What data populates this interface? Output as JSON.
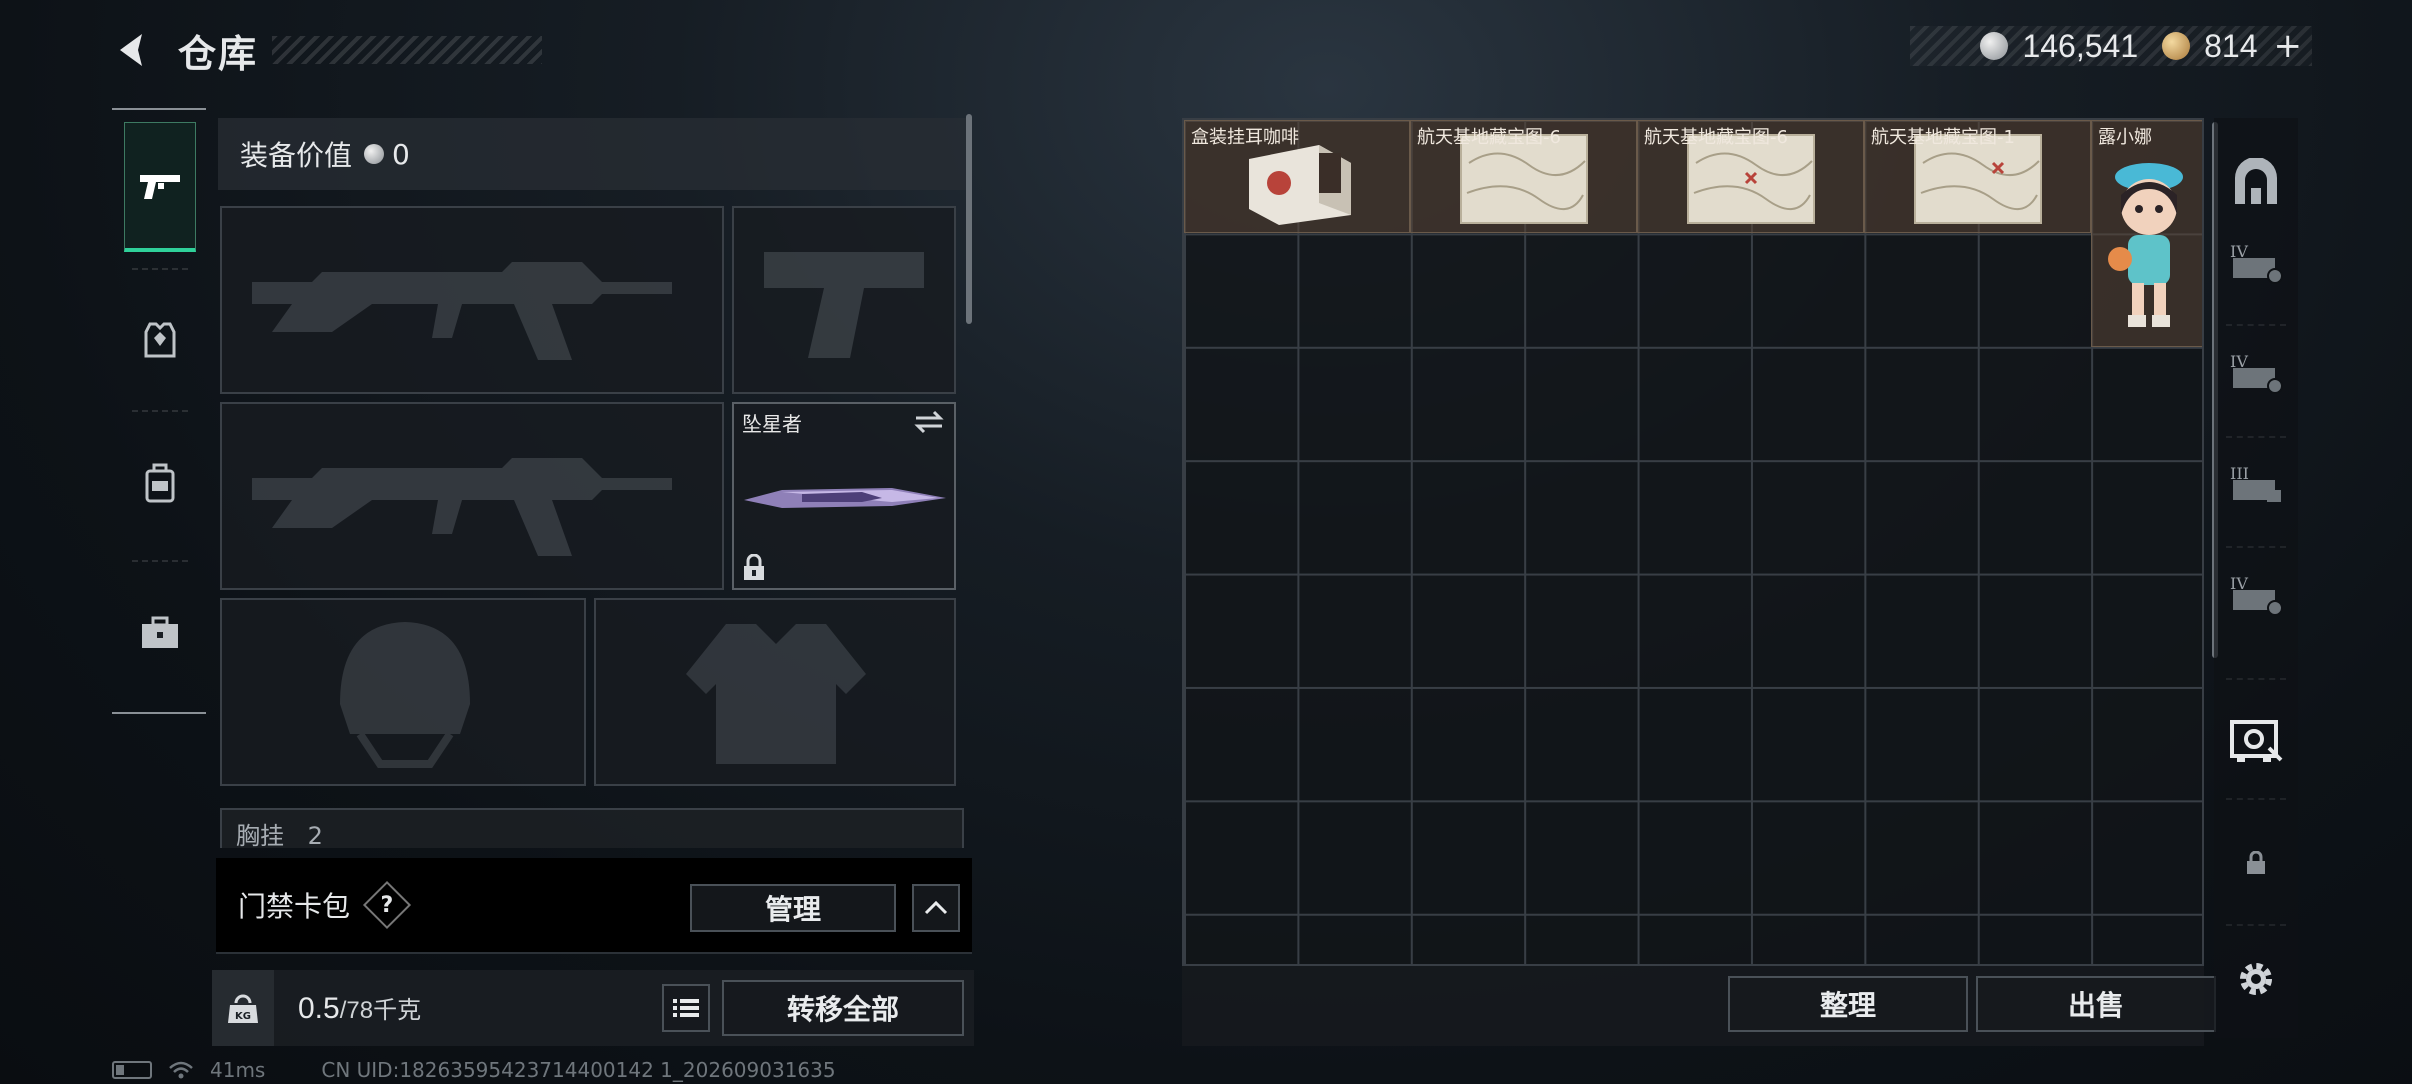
{
  "header": {
    "title": "仓库",
    "silver_amount": "146,541",
    "gold_amount": "814",
    "plus": "+"
  },
  "equipment": {
    "value_label": "装备价值",
    "value": "0",
    "melee_slot_label": "坠星者",
    "chest_row_label": "胸挂",
    "chest_row_count": "2"
  },
  "keycard": {
    "title": "门禁卡包",
    "help": "?",
    "manage_label": "管理"
  },
  "weight": {
    "kg_label": "KG",
    "current": "0.5",
    "max": "/78千克",
    "transfer_all_label": "转移全部"
  },
  "stash": {
    "items": [
      {
        "name": "盒装挂耳咖啡"
      },
      {
        "name": "航天基地藏宝图-6"
      },
      {
        "name": "航天基地藏宝图-6"
      },
      {
        "name": "航天基地藏宝图-1"
      },
      {
        "name": "露小娜"
      }
    ],
    "sort_label": "整理",
    "sell_label": "出售"
  },
  "right_bar": {
    "tiers": [
      "IV",
      "IV",
      "III",
      "IV"
    ]
  },
  "status": {
    "ping": "41ms",
    "uid": "CN UID:18263595423714400142 1_202609031635"
  },
  "colors": {
    "accent_green": "#2fd19a",
    "item_bg": "#5a4637",
    "panel_border": "#3a4047"
  }
}
